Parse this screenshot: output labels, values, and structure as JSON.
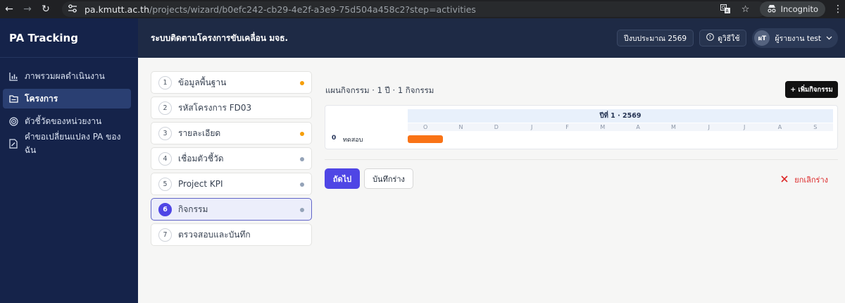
{
  "browser": {
    "url_host": "pa.kmutt.ac.th",
    "url_path": "/projects/wizard/b0efc242-cb29-4e2f-a3e9-75d504a458c2?step=activities",
    "incognito_label": "Incognito",
    "icons": [
      "back-arrow-icon",
      "forward-arrow-icon",
      "reload-icon",
      "site-settings-icon",
      "translate-icon",
      "star-icon",
      "incognito-icon",
      "kebab-menu-icon"
    ]
  },
  "app": {
    "brand": "PA Tracking",
    "page_title": "ระบบติดตามโครงการขับเคลื่อน มจธ."
  },
  "sidebar": {
    "items": [
      {
        "label": "ภาพรวมผลดำเนินงาน",
        "icon": "bar-chart-icon",
        "active": false
      },
      {
        "label": "โครงการ",
        "icon": "folder-icon",
        "active": true
      },
      {
        "label": "ตัวชี้วัดของหน่วยงาน",
        "icon": "target-icon",
        "active": false
      },
      {
        "label": "คำขอเปลี่ยนแปลง PA ของฉัน",
        "icon": "document-edit-icon",
        "active": false
      }
    ]
  },
  "topbar": {
    "fiscal_year": "ปีงบประมาณ 2569",
    "help": "ดูวิธีใช้",
    "user_initials": "ผT",
    "user_name": "ผู้รายงาน test"
  },
  "steps": [
    {
      "num": "1",
      "label": "ข้อมูลพื้นฐาน",
      "dot": "#f59e0b",
      "active": false
    },
    {
      "num": "2",
      "label": "รหัสโครงการ FD03",
      "dot": "",
      "active": false
    },
    {
      "num": "3",
      "label": "รายละเอียด",
      "dot": "#f59e0b",
      "active": false
    },
    {
      "num": "4",
      "label": "เชื่อมตัวชี้วัด",
      "dot": "#94a3b8",
      "active": false
    },
    {
      "num": "5",
      "label": "Project KPI",
      "dot": "#94a3b8",
      "active": false
    },
    {
      "num": "6",
      "label": "กิจกรรม",
      "dot": "#94a3b8",
      "active": true
    },
    {
      "num": "7",
      "label": "ตรวจสอบและบันทึก",
      "dot": "",
      "active": false
    }
  ],
  "main": {
    "plan_title": "แผนกิจกรรม · 1 ปี · 1 กิจกรรม",
    "add_button": "+ เพิ่มกิจกรรม",
    "year_label": "ปีที่ 1 · 2569",
    "months": [
      "O",
      "N",
      "D",
      "J",
      "F",
      "M",
      "A",
      "M",
      "J",
      "J",
      "A",
      "S"
    ],
    "activity": {
      "index": "0",
      "name": "ทดสอบ",
      "bar_color": "#f97316",
      "start_month_index": 0,
      "months_span": 1
    },
    "next_button": "ถัดไป",
    "save_draft_button": "บันทึกร่าง",
    "cancel_draft": "ยกเลิกร่าง"
  }
}
